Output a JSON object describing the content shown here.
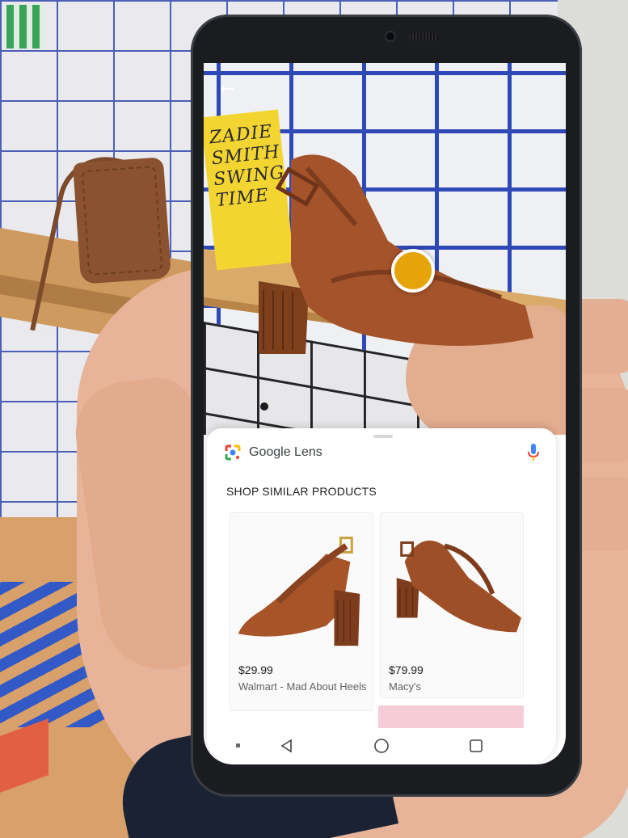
{
  "lens": {
    "brand_name": "Google Lens",
    "section_title": "SHOP SIMILAR PRODUCTS"
  },
  "products": [
    {
      "price": "$29.99",
      "store": "Walmart - Mad About Heels"
    },
    {
      "price": "$79.99",
      "store": "Macy's"
    }
  ],
  "book_cover": {
    "lines": [
      "ZADIE",
      "SMITH",
      "SWING",
      "TIME"
    ]
  },
  "colors": {
    "lens_dot": "#e5a50a",
    "sheet_background": "#ffffff",
    "grid_blue": "#2f48b7",
    "shoe_leather": "#a4532a"
  },
  "icons": {
    "back": "back-arrow-icon",
    "lens_logo": "google-lens-icon",
    "mic": "microphone-icon",
    "nav_back": "triangle-back-icon",
    "nav_home": "circle-home-icon",
    "nav_recents": "square-recents-icon"
  }
}
